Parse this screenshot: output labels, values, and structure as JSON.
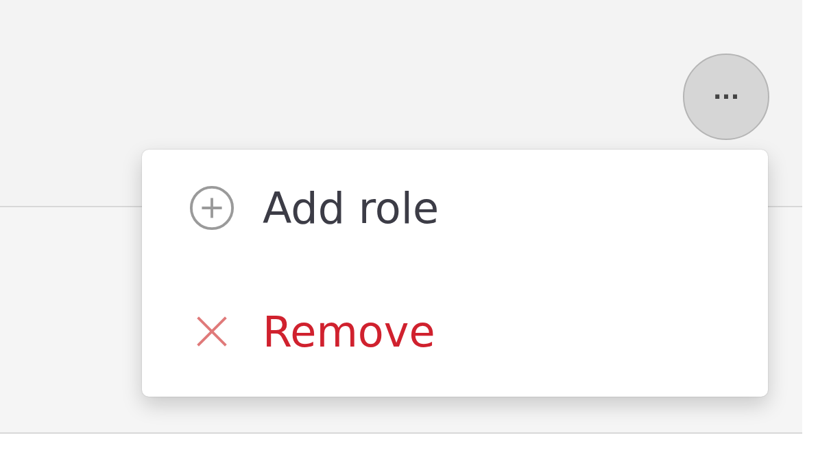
{
  "more_button": {
    "label": "···"
  },
  "menu": {
    "items": [
      {
        "kind": "add",
        "label": "Add role"
      },
      {
        "kind": "remove",
        "label": "Remove"
      }
    ]
  }
}
